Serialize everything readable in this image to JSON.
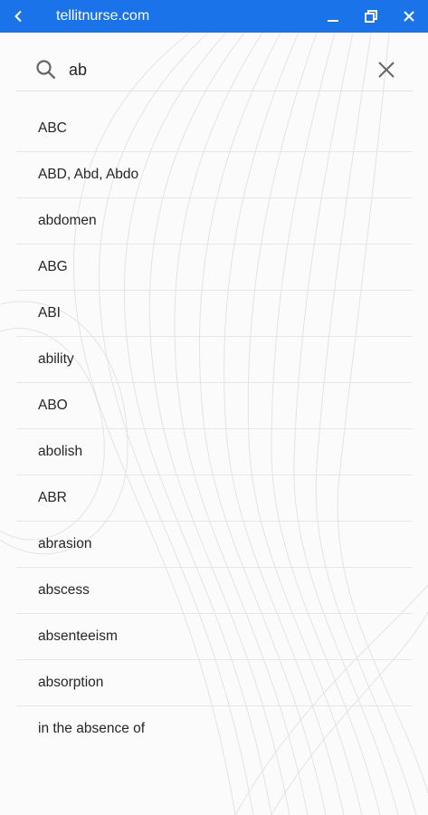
{
  "titlebar": {
    "title": "tellitnurse.com",
    "back_icon": "chevron-left-icon",
    "minimize_icon": "minimize-icon",
    "restore_icon": "restore-icon",
    "close_icon": "close-icon"
  },
  "search": {
    "value": "ab",
    "search_icon": "search-icon",
    "clear_icon": "clear-icon"
  },
  "results": [
    "ABC",
    "ABD, Abd, Abdo",
    "abdomen",
    "ABG",
    "ABI",
    "ability",
    "ABO",
    "abolish",
    "ABR",
    "abrasion",
    "abscess",
    "absenteeism",
    "absorption",
    "in the absence of"
  ],
  "colors": {
    "titlebar": "#1a73e8",
    "text": "#262626",
    "divider": "#e6e6e6"
  }
}
